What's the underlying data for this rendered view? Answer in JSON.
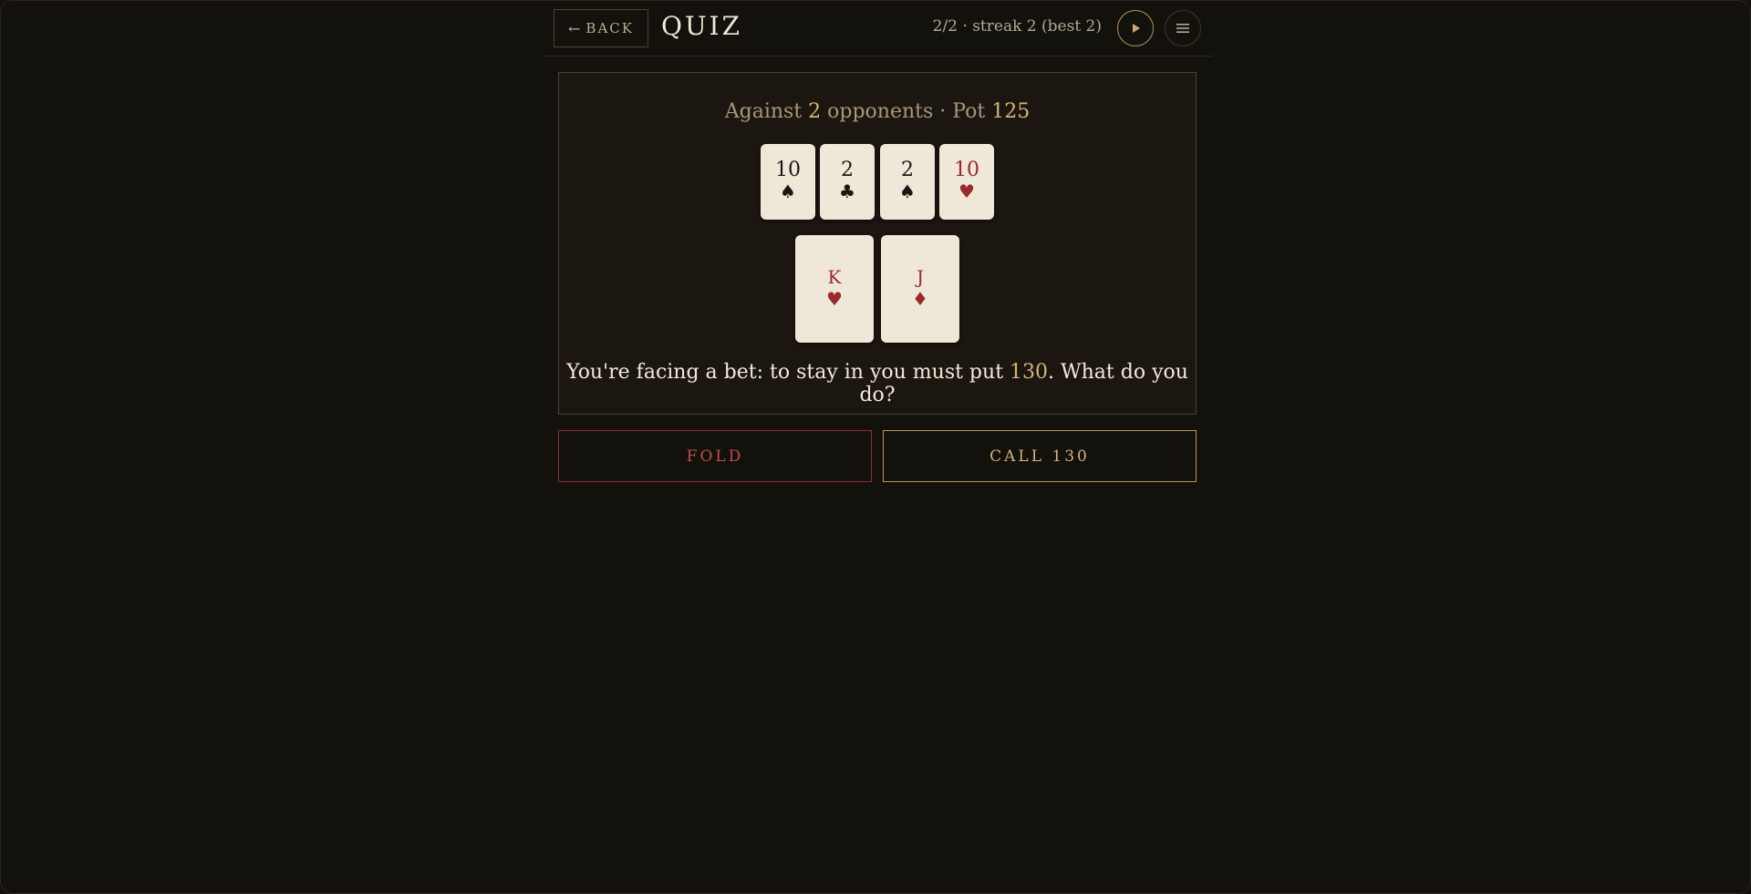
{
  "header": {
    "back_arrow": "←",
    "back_label": "BACK",
    "title": "QUIZ",
    "progress": "2/2 · streak 2 (best 2)",
    "play_icon": "play-icon",
    "menu_icon": "menu-icon"
  },
  "situation": {
    "prefix": "Against ",
    "opponents": "2",
    "middle": " opponents · Pot ",
    "pot": "125"
  },
  "board": [
    {
      "rank": "10",
      "suit": "♠",
      "color": "black"
    },
    {
      "rank": "2",
      "suit": "♣",
      "color": "black"
    },
    {
      "rank": "2",
      "suit": "♠",
      "color": "black"
    },
    {
      "rank": "10",
      "suit": "♥",
      "color": "red"
    }
  ],
  "hole": [
    {
      "rank": "K",
      "suit": "♥",
      "color": "red"
    },
    {
      "rank": "J",
      "suit": "♦",
      "color": "red"
    }
  ],
  "question": {
    "prefix": "You're facing a bet: to stay in you must put ",
    "amount": "130",
    "suffix": ". What do you do?"
  },
  "actions": {
    "fold_label": "FOLD",
    "call_label": "CALL 130"
  },
  "colors": {
    "background": "#13110c",
    "panel": "#1c1611",
    "gold": "#b8945c",
    "fold_red": "#8e2f2f",
    "card": "#efe8d8",
    "red_suit": "#9a2a2a"
  }
}
